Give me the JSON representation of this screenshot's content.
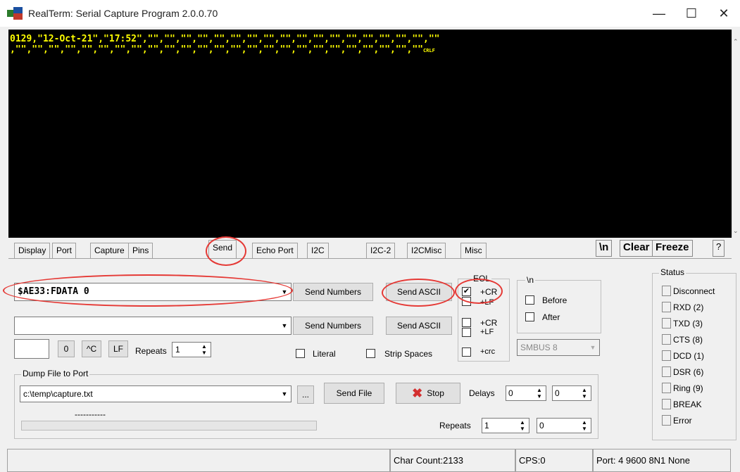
{
  "window": {
    "title": "RealTerm: Serial Capture Program 2.0.0.70",
    "minimize": "—",
    "maximize": "☐",
    "close": "✕"
  },
  "terminal": {
    "line1": "0129,\"12-Oct-21\",\"17:52\",\"\",\"\",\"\",\"\",\"\",\"\",\"\",\"\",\"\",\"\",\"\",\"\",\"\",\"\",\"\",\"\",\"\",\"\"",
    "line2": ",\"\",\"\",\"\",\"\",\"\",\"\",\"\",\"\",\"\",\"\",\"\",\"\",\"\",\"\",\"\",\"\",\"\",\"\",\"\",\"\",\"\",\"\",\"\",\"\",\"\"",
    "crlf": "CRLF"
  },
  "tabs": [
    "Display",
    "Port",
    "Capture",
    "Pins",
    "Send",
    "Echo Port",
    "I2C",
    "I2C-2",
    "I2CMisc",
    "Misc"
  ],
  "active_tab": "Send",
  "top_buttons": {
    "newline": "\\n",
    "clear": "Clear",
    "freeze": "Freeze",
    "help": "?"
  },
  "send": {
    "line1_value": "$AE33:FDATA 0",
    "line2_value": "",
    "send_numbers": "Send Numbers",
    "send_ascii": "Send ASCII",
    "zero": "0",
    "ctrl_c": "^C",
    "lf": "LF",
    "repeats_label": "Repeats",
    "repeats_value": "1",
    "literal": "Literal",
    "strip_spaces": "Strip Spaces",
    "eol_label": "EOL",
    "eol1_cr": "+CR",
    "eol1_lf": "+LF",
    "eol2_cr": "+CR",
    "eol2_lf": "+LF",
    "eol_crc": "+crc",
    "n_label": "\\n",
    "before": "Before",
    "after": "After",
    "smbus": "SMBUS 8"
  },
  "dump": {
    "group_label": "Dump File to Port",
    "file": "c:\\temp\\capture.txt",
    "browse": "...",
    "dashes": "-----------",
    "send_file": "Send File",
    "stop": "Stop",
    "delays_label": "Delays",
    "delay1": "0",
    "delay2": "0",
    "repeats_label": "Repeats",
    "repeats1": "1",
    "repeats2": "0"
  },
  "status": {
    "label": "Status",
    "items": [
      "Disconnect",
      "RXD (2)",
      "TXD (3)",
      "CTS (8)",
      "DCD (1)",
      "DSR (6)",
      "Ring (9)",
      "BREAK",
      "Error"
    ]
  },
  "statusbar": {
    "char_count": "Char Count:2133",
    "cps": "CPS:0",
    "port": "Port: 4 9600 8N1 None"
  }
}
